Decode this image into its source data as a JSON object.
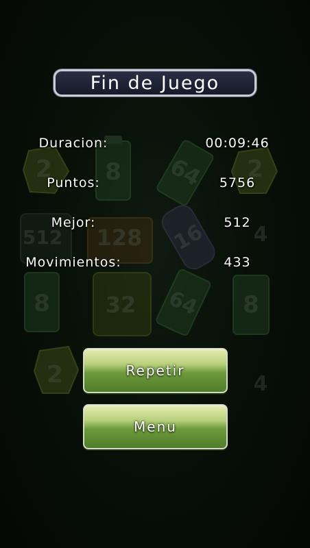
{
  "title": "Fin de Juego",
  "stats": [
    {
      "label": "Duracion:",
      "value": "00:09:46"
    },
    {
      "label": "Puntos:",
      "value": "5756"
    },
    {
      "label": "Mejor:",
      "value": "512"
    },
    {
      "label": "Movimientos:",
      "value": "433"
    }
  ],
  "buttons": {
    "replay_label": "Repetir",
    "menu_label": "Menu"
  },
  "background_tiles": [
    "2",
    "8",
    "64",
    "2",
    "512",
    "128",
    "16",
    "4",
    "8",
    "32",
    "64",
    "8",
    "2",
    "4"
  ],
  "colors": {
    "background": "#081008",
    "title_box": "#1c2030",
    "button_top": "#e6ecb0",
    "button_bottom": "#4f7e2a"
  }
}
